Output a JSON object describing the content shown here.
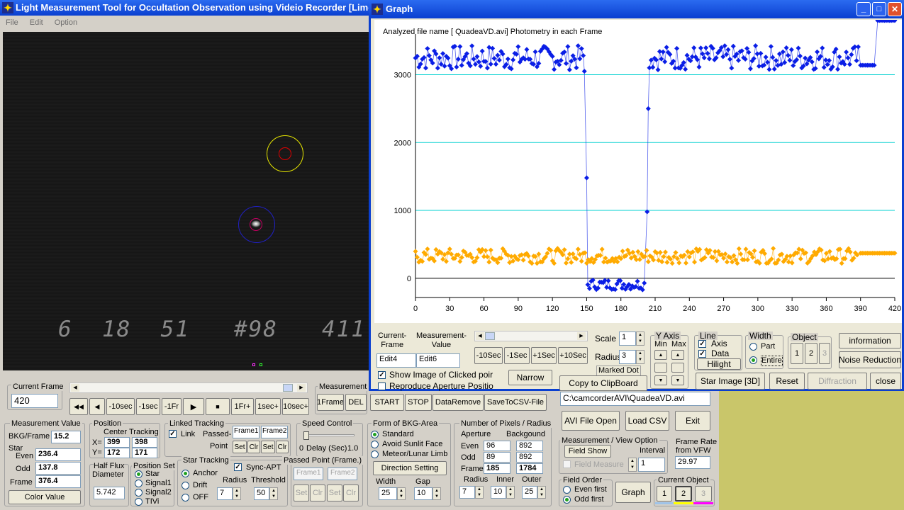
{
  "main": {
    "title": "Light Measurement Tool for Occultation Observation using Videio Recorder [Limc",
    "menu": [
      "File",
      "Edit",
      "Option"
    ],
    "video": {
      "overlay_text": "6  18  51   #98   411"
    },
    "current_frame": {
      "label": "Current Frame",
      "value": "420"
    },
    "nav": [
      "◀◀",
      "◀",
      "-10sec",
      "-1sec",
      "-1Fr",
      "▶",
      "■",
      "1Fr+",
      "1sec+",
      "10sec+"
    ],
    "measurement_group": {
      "label": "Measurement",
      "frame_btn": "1Frame",
      "del_btn": "DEL"
    },
    "actions": [
      "START",
      "STOP",
      "DataRemove",
      "SaveToCSV-File"
    ],
    "meas_value": {
      "label": "Measurement Value",
      "bkg_label": "BKG/Frame",
      "bkg": "15.2",
      "star_label": "Star",
      "even_label": "Even",
      "even": "236.4",
      "odd_label": "Odd",
      "odd": "137.8",
      "frame_label": "Frame",
      "frame": "376.4",
      "color_btn": "Color Value"
    },
    "position": {
      "label": "Position",
      "center": "Center",
      "tracking": "Tracking",
      "x_label": "X=",
      "y_label": "Y=",
      "cx": "399",
      "cy": "172",
      "tx": "398",
      "ty": "171"
    },
    "half_flux": {
      "label1": "Half Flux",
      "label2": "Diameter",
      "value": "5.742"
    },
    "position_set": {
      "label": "Position Set",
      "options": [
        "Star",
        "Signal1",
        "Signal2",
        "TIVi"
      ]
    },
    "linked": {
      "label": "Linked Tracking",
      "link": "Link",
      "passed": "Passed-",
      "point": "Point",
      "f1": "Frame1",
      "f2": "Frame2",
      "set": "Set",
      "clr": "Clr"
    },
    "speed": {
      "label": "Speed Control",
      "min": "0",
      "delay": "Delay (Sec)",
      "max": "1.0"
    },
    "star_tracking": {
      "label": "Star Tracking",
      "options": [
        "Anchor",
        "Drift",
        "OFF"
      ],
      "sync": "Sync-APT",
      "radius_label": "Radius",
      "radius": "7",
      "threshold_label": "Threshold",
      "threshold": "50"
    },
    "passed_point": {
      "label": "Passed Point (Frame.)",
      "f1": "Frame1",
      "f2": "Frame2",
      "set": "Set",
      "clr": "Clr"
    },
    "bkg_area": {
      "label": "Form of BKG-Area",
      "options": [
        "Standard",
        "Avoid Sunlit Face",
        "Meteor/Lunar Limb"
      ],
      "dir_btn": "Direction Setting",
      "width_label": "Width",
      "width": "25",
      "gap_label": "Gap",
      "gap": "10"
    },
    "pixels": {
      "label": "Number of Pixels / Radius",
      "aperture": "Aperture",
      "background": "Backgound",
      "even_label": "Even",
      "odd_label": "Odd",
      "frame_label": "Frame",
      "ap_even": "96",
      "ap_odd": "89",
      "ap_frame": "185",
      "bg_even": "892",
      "bg_odd": "892",
      "bg_frame": "1784",
      "radius_label": "Radius",
      "inner_label": "Inner",
      "outer_label": "Outer",
      "radius": "7",
      "inner": "10",
      "outer": "25"
    },
    "file": {
      "path": "C:\\camcorderAVI\\QuadeaVD.avi",
      "avi_btn": "AVI File Open",
      "csv_btn": "Load CSV",
      "exit_btn": "Exit"
    },
    "view_option": {
      "label": "Measurement / View Option",
      "field_show": "Field Show",
      "interval_label": "Interval",
      "field_measure": "Field Measure",
      "interval": "1"
    },
    "frame_rate": {
      "label1": "Frame Rate",
      "label2": "from VFW",
      "value": "29.97"
    },
    "field_order": {
      "label": "Field Order",
      "options": [
        "Even first",
        "Odd first"
      ],
      "graph_btn": "Graph"
    },
    "current_object": {
      "label": "Current Object",
      "items": [
        "1",
        "2",
        "3"
      ]
    }
  },
  "graph": {
    "title": "Graph",
    "analyzed": "Analyzed file name [ QuadeaVD.avi]   Photometry in each Frame",
    "current_frame_label": "Current-\nFrame",
    "measurement_value_label": "Measurement-\nValue",
    "edit4": "Edit4",
    "edit6": "Edit6",
    "time_btns": [
      "-10Sec",
      "-1Sec",
      "+1Sec",
      "+10Sec"
    ],
    "scale_label": "Scale",
    "scale": "1",
    "radius_label": "Radius",
    "radius": "3",
    "marked_dot": "Marked Dot",
    "yaxis": {
      "label": "Y Axis",
      "min": "Min",
      "max": "Max"
    },
    "line": {
      "label": "Line",
      "axis": "Axis",
      "data": "Data",
      "hilight": "Hilight"
    },
    "width": {
      "label": "Width",
      "part": "Part",
      "entire": "Entire"
    },
    "object": {
      "label": "Object",
      "items": [
        "1",
        "2",
        "3"
      ]
    },
    "information": "information",
    "noise": "Noise Reduction",
    "show_image": "Show Image of Clicked poir",
    "reproduce": "Reproduce Aperture Positio",
    "narrow": "Narrow",
    "copy": "Copy to ClipBoard",
    "star_image": "Star Image [3D]",
    "reset": "Reset",
    "diffraction": "Diffraction",
    "close": "close"
  },
  "chart_data": {
    "type": "scatter",
    "title": "",
    "xlabel": "",
    "ylabel": "",
    "xlim": [
      0,
      420
    ],
    "ylim": [
      -200,
      3600
    ],
    "x_ticks": [
      0,
      30,
      60,
      90,
      120,
      150,
      180,
      210,
      240,
      270,
      300,
      330,
      360,
      390,
      420
    ],
    "y_ticks": [
      0,
      1000,
      2000,
      3000
    ],
    "series": [
      {
        "color": "#0a1ee6",
        "segments": [
          {
            "from": 0,
            "to": 147,
            "mean": 3250,
            "jitter": 180
          },
          {
            "from": 148,
            "to": 148,
            "mean": 3050,
            "jitter": 0
          },
          {
            "from": 150,
            "to": 150,
            "mean": 1480,
            "jitter": 0
          },
          {
            "from": 151,
            "to": 201,
            "mean": -90,
            "jitter": 80
          },
          {
            "from": 203,
            "to": 203,
            "mean": 980,
            "jitter": 0
          },
          {
            "from": 204,
            "to": 204,
            "mean": 2500,
            "jitter": 0
          },
          {
            "from": 205,
            "to": 388,
            "mean": 3250,
            "jitter": 180
          },
          {
            "from": 390,
            "to": 403,
            "mean": 3140,
            "jitter": 0
          },
          {
            "from": 405,
            "to": 420,
            "mean": 3800,
            "jitter": 0
          }
        ]
      },
      {
        "color": "#ffaa00",
        "segments": [
          {
            "from": 0,
            "to": 388,
            "mean": 330,
            "jitter": 110
          },
          {
            "from": 390,
            "to": 420,
            "mean": 370,
            "jitter": 0
          }
        ]
      }
    ]
  }
}
